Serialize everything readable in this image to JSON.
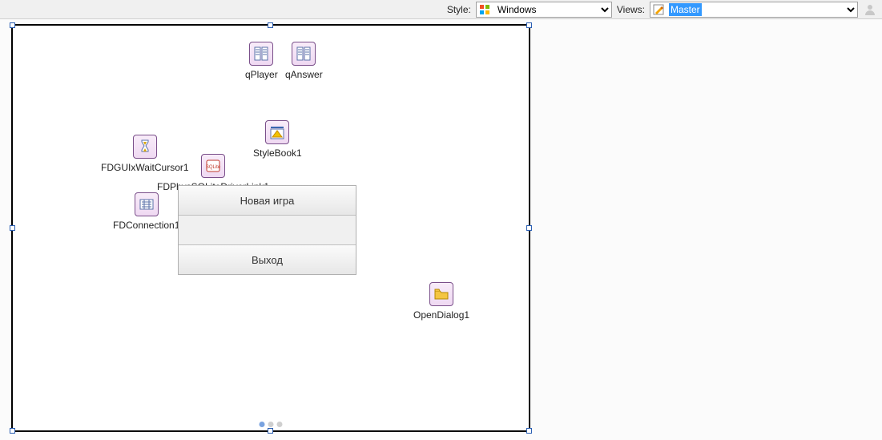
{
  "toolbar": {
    "style_label": "Style:",
    "style_value": "Windows",
    "views_label": "Views:",
    "views_value": "Master"
  },
  "components": {
    "qPlayer": "qPlayer",
    "qAnswer": "qAnswer",
    "FDGUIxWaitCursor1": "FDGUIxWaitCursor1",
    "FDPhysSQLiteDriverLink1": "FDPhysSQLiteDriverLink1",
    "StyleBook1": "StyleBook1",
    "FDConnection1": "FDConnection1",
    "OpenDialog1": "OpenDialog1"
  },
  "panel": {
    "btn1": "Новая игра",
    "btn2": "",
    "btn3": "Выход"
  }
}
